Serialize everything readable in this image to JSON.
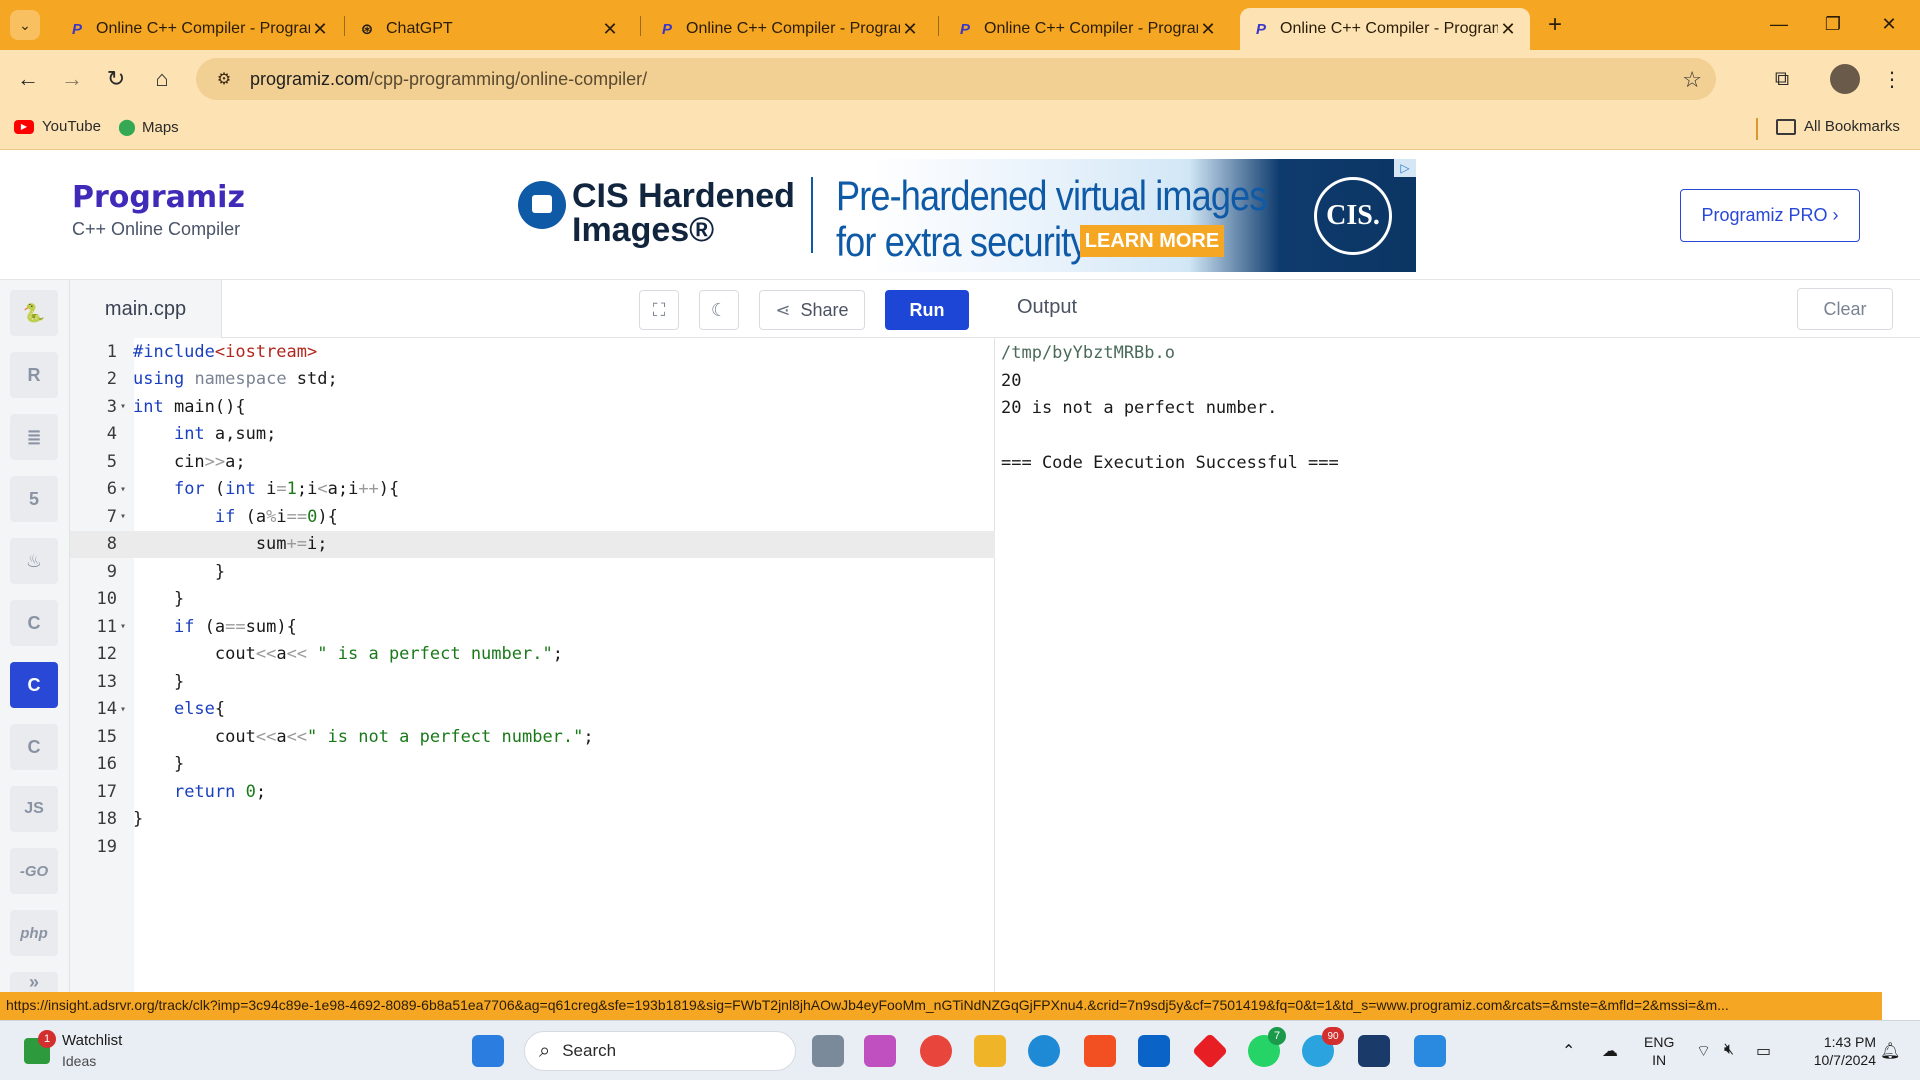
{
  "browser": {
    "tabs": [
      {
        "label": "Online C++ Compiler - Program",
        "favicon": "programiz-icon",
        "active": false
      },
      {
        "label": "ChatGPT",
        "favicon": "chatgpt-icon",
        "active": false
      },
      {
        "label": "Online C++ Compiler - Program",
        "favicon": "programiz-icon",
        "active": false
      },
      {
        "label": "Online C++ Compiler - Program",
        "favicon": "programiz-icon",
        "active": false
      },
      {
        "label": "Online C++ Compiler - Program",
        "favicon": "programiz-icon",
        "active": true
      }
    ],
    "url_host": "programiz.com",
    "url_path": "/cpp-programming/online-compiler/",
    "bookmarks": [
      {
        "label": "YouTube",
        "icon": "youtube-icon"
      },
      {
        "label": "Maps",
        "icon": "maps-icon"
      }
    ],
    "all_bookmarks_label": "All Bookmarks"
  },
  "header": {
    "logo_text": "Programiz",
    "subtitle": "C++ Online Compiler",
    "pro_button": "Programiz PRO ›"
  },
  "ad": {
    "brand_line1": "CIS Hardened",
    "brand_line2": "Images®",
    "headline_line1": "Pre-hardened virtual images",
    "headline_line2": "for extra security.",
    "cta": "LEARN MORE",
    "logo_text": "CIS."
  },
  "editor": {
    "file_name": "main.cpp",
    "share_label": "Share",
    "run_label": "Run",
    "active_line": 8,
    "lines": [
      {
        "num": "1",
        "fold": "",
        "html": "<span class=\"pp\">#include</span><span class=\"inc\">&lt;iostream&gt;</span>"
      },
      {
        "num": "2",
        "fold": "",
        "html": "<span class=\"k\">using</span> <span class=\"o\" style=\"color:#7a8394\">namespace</span> std;"
      },
      {
        "num": "3",
        "fold": "▾",
        "html": "<span class=\"k\">int</span> main(){"
      },
      {
        "num": "4",
        "fold": "",
        "html": "    <span class=\"k\">int</span> a,sum;"
      },
      {
        "num": "5",
        "fold": "",
        "html": "    cin<span class=\"o\">&gt;&gt;</span>a;"
      },
      {
        "num": "6",
        "fold": "▾",
        "html": "    <span class=\"k\">for</span> (<span class=\"k\">int</span> i<span class=\"o\">=</span><span class=\"s\">1</span>;i<span class=\"o\">&lt;</span>a;i<span class=\"o\">++</span>){"
      },
      {
        "num": "7",
        "fold": "▾",
        "html": "        <span class=\"k\">if</span> (a<span class=\"o\">%</span>i<span class=\"o\">==</span><span class=\"s\">0</span>){"
      },
      {
        "num": "8",
        "fold": "",
        "html": "            sum<span class=\"o\">+=</span>i;"
      },
      {
        "num": "9",
        "fold": "",
        "html": "        }"
      },
      {
        "num": "10",
        "fold": "",
        "html": "    }"
      },
      {
        "num": "11",
        "fold": "▾",
        "html": "    <span class=\"k\">if</span> (a<span class=\"o\">==</span>sum){"
      },
      {
        "num": "12",
        "fold": "",
        "html": "        cout<span class=\"o\">&lt;&lt;</span>a<span class=\"o\">&lt;&lt;</span> <span class=\"s\">\" is a perfect number.\"</span>;"
      },
      {
        "num": "13",
        "fold": "",
        "html": "    }"
      },
      {
        "num": "14",
        "fold": "▾",
        "html": "    <span class=\"k\">else</span>{"
      },
      {
        "num": "15",
        "fold": "",
        "html": "        cout<span class=\"o\">&lt;&lt;</span>a<span class=\"o\">&lt;&lt;</span><span class=\"s\">\" is not a perfect number.\"</span>;"
      },
      {
        "num": "16",
        "fold": "",
        "html": "    }"
      },
      {
        "num": "17",
        "fold": "",
        "html": "    <span class=\"k\">return</span> <span class=\"s\">0</span>;"
      },
      {
        "num": "18",
        "fold": "",
        "html": "}"
      },
      {
        "num": "19",
        "fold": "",
        "html": ""
      }
    ]
  },
  "output": {
    "title": "Output",
    "clear_label": "Clear",
    "lines": [
      "/tmp/byYbztMRBb.o",
      "20",
      "20 is not a perfect number.",
      "",
      "=== Code Execution Successful ==="
    ]
  },
  "status_link": "https://insight.adsrvr.org/track/clk?imp=3c94c89e-1e98-4692-8089-6b8a51ea7706&ag=q61creg&sfe=193b1819&sig=FWbT2jnl8jhAOwJb4eyFooMm_nGTiNdNZGqGjFPXnu4.&crid=7n9sdj5y&cf=7501419&fq=0&t=1&td_s=www.programiz.com&rcats=&mste=&mfld=2&mssi=&m...",
  "taskbar": {
    "watchlist_title": "Watchlist",
    "watchlist_sub": "Ideas",
    "watchlist_badge": "1",
    "search_label": "Search",
    "lang_top": "ENG",
    "lang_bottom": "IN",
    "time": "1:43 PM",
    "date": "10/7/2024",
    "whatsapp_badge": "7",
    "telegram_badge": "90"
  }
}
